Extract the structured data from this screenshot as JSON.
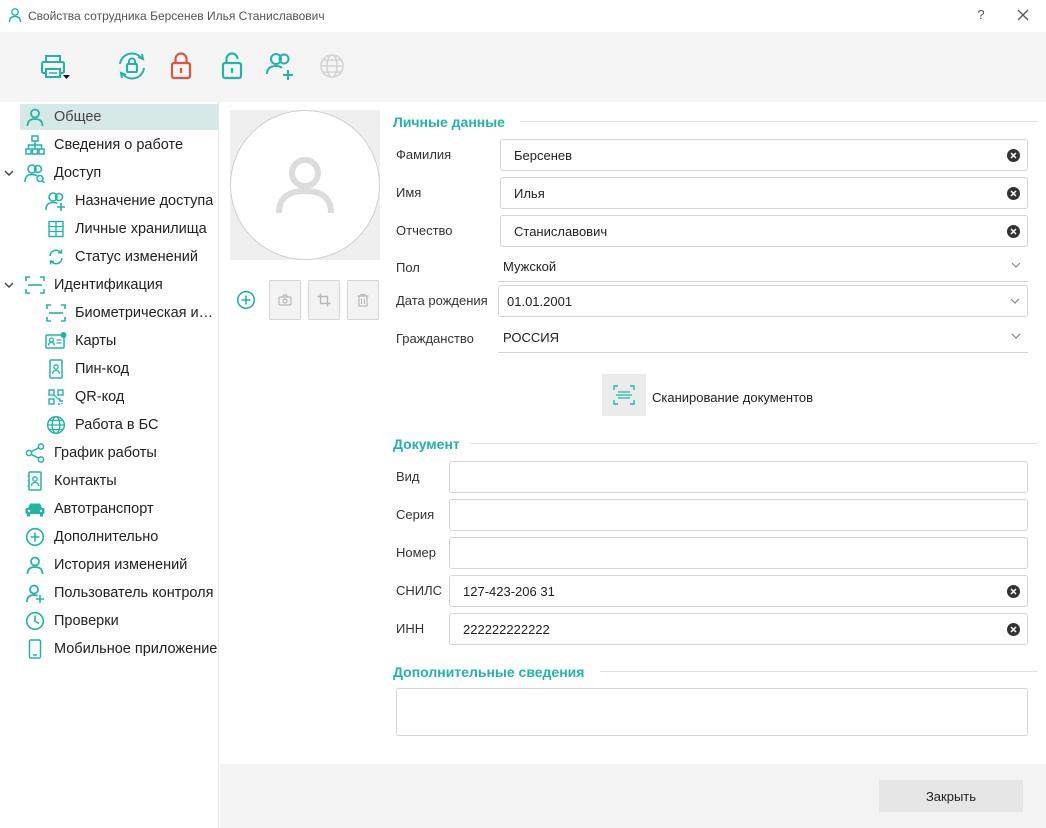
{
  "window": {
    "title": "Свойства сотрудника Берсенев Илья Станиславович",
    "help_label": "?"
  },
  "toolbar": {
    "buttons": [
      {
        "name": "print-icon",
        "color": "#22b5a5"
      },
      {
        "name": "sync-lock-icon",
        "color": "#22b5a5"
      },
      {
        "name": "lock-closed-icon",
        "color": "#e2553b"
      },
      {
        "name": "lock-open-icon",
        "color": "#22b5a5"
      },
      {
        "name": "add-user-icon",
        "color": "#22b5a5"
      },
      {
        "name": "globe-icon",
        "color": "#d4d4d4"
      }
    ]
  },
  "sidebar": {
    "items": [
      {
        "label": "Общее",
        "icon": "user-icon",
        "active": true
      },
      {
        "label": "Сведения о работе",
        "icon": "org-structure-icon"
      },
      {
        "label": "Доступ",
        "icon": "users-access-icon"
      },
      {
        "label": "Назначение доступа",
        "icon": "user-add-icon"
      },
      {
        "label": "Личные хранилища",
        "icon": "grid-storage-icon"
      },
      {
        "label": "Статус изменений",
        "icon": "refresh-icon"
      },
      {
        "label": "Идентификация",
        "icon": "scan-frame-icon"
      },
      {
        "label": "Биометрическая идентификация",
        "icon": "biometric-scan-icon"
      },
      {
        "label": "Карты",
        "icon": "card-icon"
      },
      {
        "label": "Пин-код",
        "icon": "pin-code-icon"
      },
      {
        "label": "QR-код",
        "icon": "qr-code-icon"
      },
      {
        "label": "Работа в БС",
        "icon": "globe-icon"
      },
      {
        "label": "График работы",
        "icon": "share-nodes-icon"
      },
      {
        "label": "Контакты",
        "icon": "contacts-book-icon"
      },
      {
        "label": "Автотранспорт",
        "icon": "car-icon"
      },
      {
        "label": "Дополнительно",
        "icon": "plus-circle-icon"
      },
      {
        "label": "История изменений",
        "icon": "user-history-icon"
      },
      {
        "label": "Пользователь контроля",
        "icon": "user-control-icon"
      },
      {
        "label": "Проверки",
        "icon": "clock-icon"
      },
      {
        "label": "Мобильное приложение",
        "icon": "mobile-phone-icon"
      }
    ]
  },
  "personal": {
    "section_title": "Личные данные",
    "last_name": {
      "label": "Фамилия",
      "value": "Берсенев"
    },
    "first_name": {
      "label": "Имя",
      "value": "Илья"
    },
    "middle_name": {
      "label": "Отчество",
      "value": "Станиславович"
    },
    "gender": {
      "label": "Пол",
      "value": "Мужской"
    },
    "birth_date": {
      "label": "Дата рождения",
      "value": "01.01.2001"
    },
    "citizenship": {
      "label": "Гражданство",
      "value": "РОССИЯ"
    },
    "scan_button_label": "Сканирование документов"
  },
  "document": {
    "section_title": "Документ",
    "type": {
      "label": "Вид",
      "value": ""
    },
    "series": {
      "label": "Серия",
      "value": ""
    },
    "number": {
      "label": "Номер",
      "value": ""
    },
    "snils": {
      "label": "СНИЛС",
      "value": "127-423-206 31"
    },
    "inn": {
      "label": "ИНН",
      "value": "222222222222"
    }
  },
  "additional": {
    "section_title": "Дополнительные сведения",
    "value": ""
  },
  "footer": {
    "close_label": "Закрыть"
  },
  "colors": {
    "accent": "#22b5a5",
    "danger": "#e2553b",
    "active_nav_bg": "#d7e9e6"
  }
}
